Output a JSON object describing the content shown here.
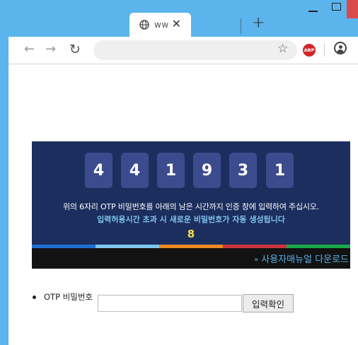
{
  "browser": {
    "tab": {
      "title": "ww",
      "favicon": "globe-icon",
      "close_label": "✕"
    },
    "new_tab_label": "+",
    "toolbar": {
      "back_icon": "back-arrow-icon",
      "forward_icon": "forward-arrow-icon",
      "reload_icon": "reload-icon",
      "bookmark_icon": "star-icon",
      "extension_label": "ABP",
      "profile_icon": "profile-icon"
    }
  },
  "otp": {
    "digits": [
      "4",
      "4",
      "1",
      "9",
      "3",
      "1"
    ],
    "instruction": "위의 6자리 OTP 비밀번호를 아래의 남은 시간까지 인증 창에 입력하여 주십시오.",
    "warning": "입력허용시간 초과 시 새로운 비밀번호가 자동 생성됩니다",
    "timer": "8",
    "manual_arrow": "»",
    "manual_link": "사용자매뉴얼 다운로드",
    "stripe_colors": [
      "#1f6fd0",
      "#7fc6ec",
      "#e88a23",
      "#c9353d",
      "#18a848"
    ]
  },
  "form": {
    "label": "OTP 비밀번호",
    "input_value": "",
    "submit_label": "입력확인"
  },
  "colors": {
    "window_frame": "#5bb4ec",
    "panel_bg": "#1c2e5e",
    "digit_bg": "#3c4b8e",
    "warning_text": "#7ec3ee",
    "timer_text": "#f2e244",
    "link_text": "#5ab1e8"
  }
}
